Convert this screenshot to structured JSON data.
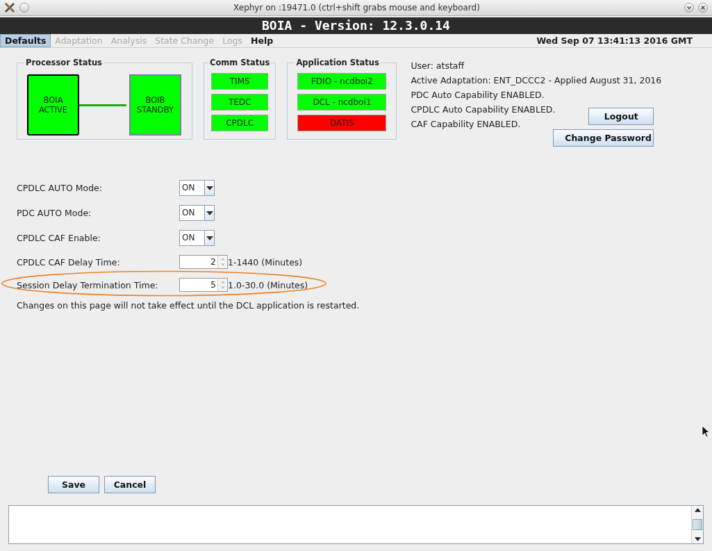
{
  "window": {
    "title": "Xephyr on :19471.0 (ctrl+shift grabs mouse and keyboard)"
  },
  "app_title": "BOIA - Version: 12.3.0.14",
  "menu": [
    {
      "label": "Defaults",
      "selected": true,
      "disabled": false
    },
    {
      "label": "Adaptation",
      "selected": false,
      "disabled": true
    },
    {
      "label": "Analysis",
      "selected": false,
      "disabled": true
    },
    {
      "label": "State Change",
      "selected": false,
      "disabled": true
    },
    {
      "label": "Logs",
      "selected": false,
      "disabled": true
    },
    {
      "label": "Help",
      "selected": false,
      "disabled": false
    }
  ],
  "datetime": "Wed Sep 07 13:41:13 2016 GMT",
  "processor_status": {
    "title": "Processor Status",
    "nodes": [
      {
        "label": "BOIA ACTIVE",
        "active": true
      },
      {
        "label": "BOIB STANDBY",
        "active": false
      }
    ]
  },
  "comm_status": {
    "title": "Comm Status",
    "items": [
      {
        "label": "TIMS",
        "color": "#00ff00"
      },
      {
        "label": "TEDC",
        "color": "#00ff00"
      },
      {
        "label": "CPDLC",
        "color": "#00ff00"
      }
    ]
  },
  "application_status": {
    "title": "Application Status",
    "items": [
      {
        "label": "FDIO - ncdboi2",
        "color": "#00ff00"
      },
      {
        "label": "DCL - ncdboi1",
        "color": "#00ff00"
      },
      {
        "label": "DATIS",
        "color": "#ff0000"
      }
    ]
  },
  "info_lines": [
    "User: atstaff",
    "Active Adaptation: ENT_DCCC2 - Applied August 31, 2016",
    "PDC Auto Capability ENABLED.",
    "CPDLC Auto Capability ENABLED.",
    "CAF Capability ENABLED."
  ],
  "account_buttons": [
    "Logout",
    "Change Password"
  ],
  "settings": [
    {
      "kind": "dropdown",
      "label": "CPDLC AUTO Mode:",
      "value": "ON"
    },
    {
      "kind": "dropdown",
      "label": "PDC AUTO Mode:",
      "value": "ON"
    },
    {
      "kind": "dropdown",
      "label": "CPDLC CAF Enable:",
      "value": "ON"
    },
    {
      "kind": "spinner",
      "label": "CPDLC CAF Delay Time:",
      "value": "2",
      "range": "1-1440 (Minutes)"
    },
    {
      "kind": "spinner",
      "label": "Session Delay Termination Time:",
      "value": "5",
      "range": "1.0-30.0 (Minutes)"
    }
  ],
  "note": "Changes on this page will not take effect until the DCL application is restarted.",
  "action_buttons": [
    "Save",
    "Cancel"
  ]
}
